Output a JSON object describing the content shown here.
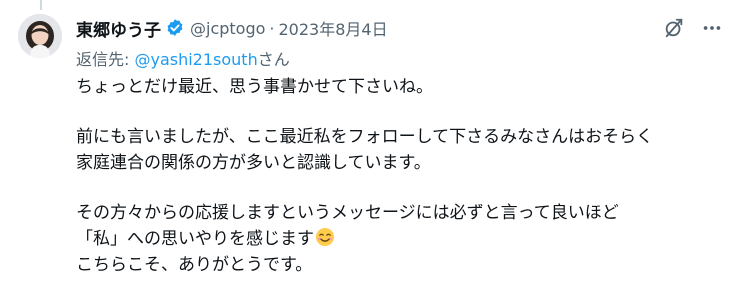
{
  "author": {
    "name": "東郷ゆう子",
    "handle": "@jcptogo",
    "separator": "·",
    "date": "2023年8月4日"
  },
  "reply": {
    "prefix": "返信先: ",
    "mention": "@yashi21south",
    "suffix": "さん"
  },
  "tweet": {
    "line1": "ちょっとだけ最近、思う事書かせて下さいね。",
    "line2": "前にも言いましたが、ここ最近私をフォローして下さるみなさんはおそらく",
    "line3": "家庭連合の関係の方が多いと認識しています。",
    "line4": "その方々からの応援しますというメッセージには必ずと言って良いほど",
    "line5": "「私」への思いやりを感じます",
    "line6": "こちらこそ、ありがとうです。"
  },
  "icons": {
    "verified": "verified-badge-icon",
    "grok": "grok-icon",
    "more": "more-icon",
    "emoji": "smiling-face-emoji"
  },
  "colors": {
    "accent": "#1d9bf0",
    "muted": "#536471",
    "text": "#0f1419"
  }
}
